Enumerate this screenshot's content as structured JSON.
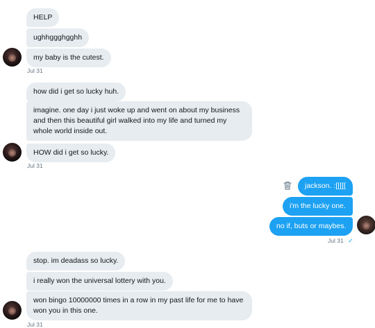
{
  "conversation": {
    "group1": {
      "messages": [
        "HELP",
        "ughhggghgghh",
        "my baby is the cutest."
      ],
      "timestamp": "Jul 31"
    },
    "group2": {
      "messages": [
        "how did i get so lucky huh.",
        "imagine. one day i just woke up and went on about my business and then this beautiful girl walked into my life and turned my whole world inside out.",
        "HOW did i get so lucky."
      ],
      "timestamp": "Jul 31"
    },
    "group3": {
      "messages": [
        "jackson. :[[[[[",
        "i'm the lucky one.",
        "no if, buts or maybes."
      ],
      "timestamp": "Jul 31",
      "read_icon": "check-icon"
    },
    "group4": {
      "messages": [
        "stop. im deadass so lucky.",
        "i really won the universal lottery with you.",
        "won bingo 10000000 times in a row in my past life for me to have won you in this one."
      ],
      "timestamp": "Jul 31"
    }
  },
  "colors": {
    "incoming_bubble": "#e6ecf0",
    "outgoing_bubble": "#1da1f2",
    "timestamp": "#657786"
  },
  "icons": {
    "delete": "trash-icon",
    "sent": "check-icon"
  }
}
